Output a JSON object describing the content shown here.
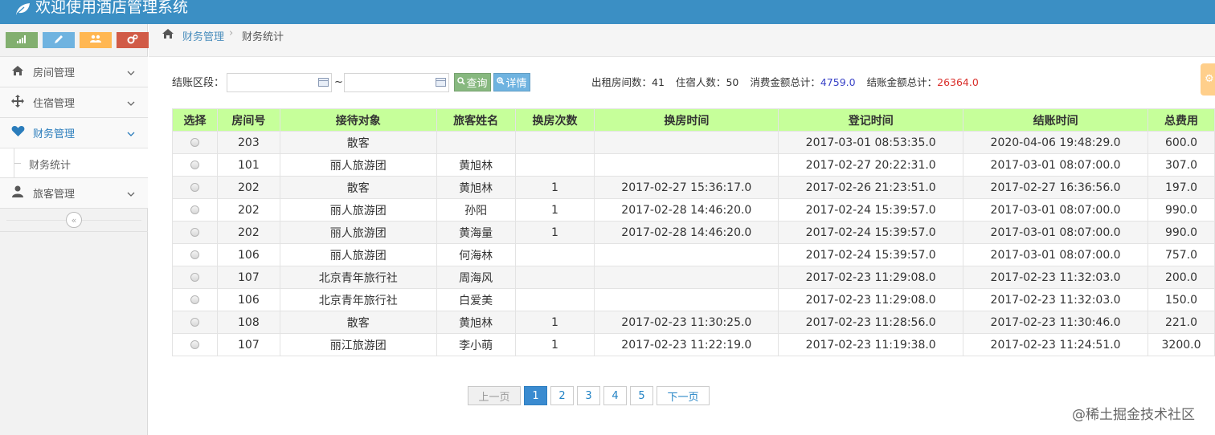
{
  "app": {
    "title": "欢迎使用酒店管理系统",
    "logo_icon": "leaf-icon"
  },
  "shortcuts": [
    {
      "icon": "signal-icon",
      "color": "#82af6f"
    },
    {
      "icon": "pencil-icon",
      "color": "#6fb3e0"
    },
    {
      "icon": "group-icon",
      "color": "#ffb752"
    },
    {
      "icon": "cogs-icon",
      "color": "#d15b47"
    }
  ],
  "sidebar": {
    "items": [
      {
        "label": "房间管理",
        "icon": "home-icon"
      },
      {
        "label": "住宿管理",
        "icon": "move-icon"
      },
      {
        "label": "财务管理",
        "icon": "heart-icon"
      },
      {
        "label": "财务统计"
      },
      {
        "label": "旅客管理",
        "icon": "user-icon"
      }
    ],
    "collapse_icon": "double-angle-left-icon"
  },
  "breadcrumb": {
    "parent": "财务管理",
    "current": "财务统计"
  },
  "filter": {
    "label": "结账区段：",
    "start_value": "",
    "end_value": "",
    "separator": "~",
    "query_label": "查询",
    "detail_label": "详情"
  },
  "stats": {
    "rented_rooms_label": "出租房间数：",
    "rented_rooms": "41",
    "guests_label": "住宿人数：",
    "guests": "50",
    "consume_label": "消费金额总计：",
    "consume": "4759.0",
    "checkout_label": "结账金额总计：",
    "checkout": "26364.0"
  },
  "table": {
    "headers": [
      "选择",
      "房间号",
      "接待对象",
      "旅客姓名",
      "换房次数",
      "换房时间",
      "登记时间",
      "结账时间",
      "总费用"
    ],
    "rows": [
      [
        "203",
        "散客",
        "",
        "",
        "",
        "2017-03-01 08:53:35.0",
        "2020-04-06 19:48:29.0",
        "600.0"
      ],
      [
        "101",
        "丽人旅游团",
        "黄旭林",
        "",
        "",
        "2017-02-27 20:22:31.0",
        "2017-03-01 08:07:00.0",
        "307.0"
      ],
      [
        "202",
        "散客",
        "黄旭林",
        "1",
        "2017-02-27 15:36:17.0",
        "2017-02-26 21:23:51.0",
        "2017-02-27 16:36:56.0",
        "197.0"
      ],
      [
        "202",
        "丽人旅游团",
        "孙阳",
        "1",
        "2017-02-28 14:46:20.0",
        "2017-02-24 15:39:57.0",
        "2017-03-01 08:07:00.0",
        "990.0"
      ],
      [
        "202",
        "丽人旅游团",
        "黄海量",
        "1",
        "2017-02-28 14:46:20.0",
        "2017-02-24 15:39:57.0",
        "2017-03-01 08:07:00.0",
        "990.0"
      ],
      [
        "106",
        "丽人旅游团",
        "何海林",
        "",
        "",
        "2017-02-24 15:39:57.0",
        "2017-03-01 08:07:00.0",
        "757.0"
      ],
      [
        "107",
        "北京青年旅行社",
        "周海风",
        "",
        "",
        "2017-02-23 11:29:08.0",
        "2017-02-23 11:32:03.0",
        "200.0"
      ],
      [
        "106",
        "北京青年旅行社",
        "白爱美",
        "",
        "",
        "2017-02-23 11:29:08.0",
        "2017-02-23 11:32:03.0",
        "150.0"
      ],
      [
        "108",
        "散客",
        "黄旭林",
        "1",
        "2017-02-23 11:30:25.0",
        "2017-02-23 11:28:56.0",
        "2017-02-23 11:30:46.0",
        "221.0"
      ],
      [
        "107",
        "丽江旅游团",
        "李小萌",
        "1",
        "2017-02-23 11:22:19.0",
        "2017-02-23 11:19:38.0",
        "2017-02-23 11:24:51.0",
        "3200.0"
      ]
    ]
  },
  "pagination": {
    "prev": "上一页",
    "pages": [
      "1",
      "2",
      "3",
      "4",
      "5"
    ],
    "current": "1",
    "next": "下一页"
  },
  "watermark": "@稀土掘金技术社区"
}
